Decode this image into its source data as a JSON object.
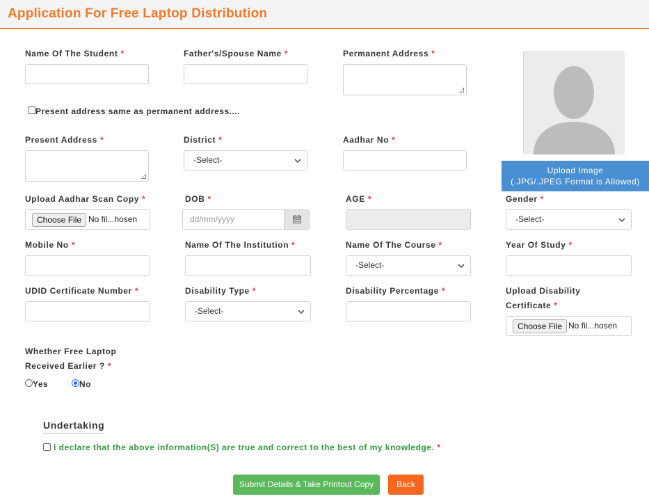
{
  "header": {
    "title": "Application For Free Laptop Distribution"
  },
  "fields": {
    "student_name": "Name Of The Student",
    "father_name": "Father's/Spouse Name",
    "permanent_address": "Permanent Address",
    "present_address": "Present Address",
    "district": "District",
    "aadhar_no": "Aadhar No",
    "aadhar_copy": "Upload Aadhar Scan Copy",
    "dob": "DOB",
    "age": "AGE",
    "gender": "Gender",
    "mobile": "Mobile No",
    "institution": "Name Of The Institution",
    "course": "Name Of The Course",
    "year_of_study": "Year Of Study",
    "udid": "UDID Certificate Number",
    "disability_type": "Disability Type",
    "disability_percentage": "Disability Percentage",
    "upload_disability_line1": "Upload Disability",
    "upload_disability_line2": "Certificate",
    "laptop_line1": "Whether Free Laptop",
    "laptop_line2": "Received Earlier ?"
  },
  "required_mark": "*",
  "same_address_label": "Present address same as permanent address....",
  "select_placeholder": "-Select-",
  "date_placeholder": "dd/mm/yyyy",
  "file_input": {
    "button": "Choose File",
    "status": "No fil...hosen"
  },
  "photo": {
    "upload_line1": "Upload Image",
    "upload_line2": "(.JPG/.JPEG Format is Allowed)"
  },
  "radios": {
    "yes": "Yes",
    "no": "No",
    "selected": "No"
  },
  "undertaking": {
    "heading": "Undertaking",
    "declaration": "I declare that the above information(S) are true and correct to the best of my knowledge."
  },
  "buttons": {
    "submit": "Submit Details & Take Printout Copy",
    "back": "Back"
  },
  "colors": {
    "accent": "#f07a2c",
    "required": "#e0373a",
    "submit": "#5cb85c",
    "back": "#f5671f",
    "upload": "#4a8fd2",
    "declaration": "#2e9a3a"
  },
  "icons": [
    "calendar-icon",
    "chevron-down-icon",
    "avatar-placeholder-icon"
  ]
}
